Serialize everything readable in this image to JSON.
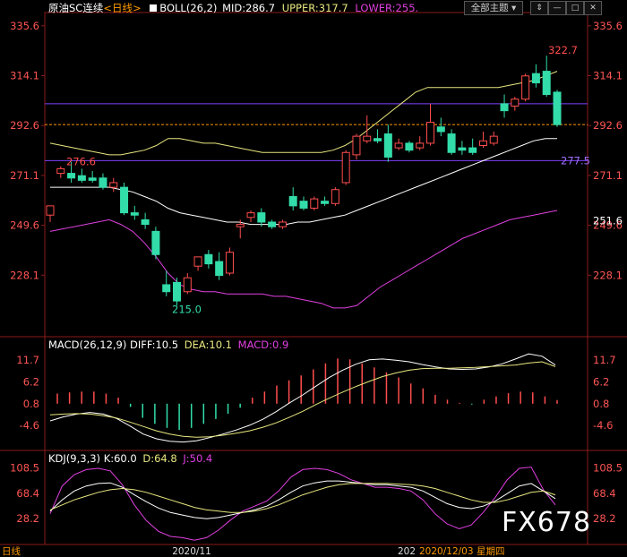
{
  "header": {
    "symbol": "原油SC连续",
    "period": "<日线>",
    "boll_label": "BOLL(26,2)",
    "mid": "MID:286.7",
    "upper": "UPPER:317.7",
    "lower": "LOWER:255.",
    "theme_button": "全部主题",
    "win_buttons": [
      "⇕",
      "—",
      "□",
      "✕"
    ]
  },
  "macd_header": {
    "label": "MACD(26,12,9)",
    "diff": "DIFF:10.5",
    "dea": "DEA:10.1",
    "macd": "MACD:0.9"
  },
  "kdj_header": {
    "label": "KDJ(9,3,3)",
    "k": "K:60.0",
    "d": "D:64.8",
    "j": "J:50.4"
  },
  "price_axis": [
    "335.6",
    "314.1",
    "292.6",
    "271.1",
    "249.6",
    "228.1"
  ],
  "price_axis_values": [
    335.6,
    314.1,
    292.6,
    271.1,
    249.6,
    228.1
  ],
  "price_right_extra": "251.6",
  "annotations": {
    "high": "322.7",
    "low": "215.0",
    "left_mark": "276.6",
    "line_mark": "277.5"
  },
  "macd_axis": [
    "11.7",
    "6.2",
    "0.8",
    "-4.6"
  ],
  "macd_axis_values": [
    11.7,
    6.2,
    0.8,
    -4.6
  ],
  "kdj_axis": [
    "108.5",
    "68.4",
    "28.2"
  ],
  "kdj_axis_values": [
    108.5,
    68.4,
    28.2
  ],
  "date_labels": [
    "2020/11",
    "202",
    "2020/12/03",
    "星期四"
  ],
  "bottom_left": "日线",
  "watermark": "FX678",
  "colors": {
    "up": "#ff4d4d",
    "down": "#33ddaa",
    "upper": "#e8e880",
    "mid": "#ffffff",
    "lower": "#e040e0",
    "purple_line": "#8040ff",
    "orange_dash": "#ff9900",
    "axis_text": "#ff5555",
    "header_mid": "#ffffff",
    "header_upper": "#e8e880",
    "header_lower": "#e040e0"
  },
  "chart_data": {
    "type": "candlestick",
    "ylim": [
      207,
      339
    ],
    "candles": [
      {
        "o": 254,
        "h": 257,
        "c": 258,
        "l": 251
      },
      {
        "o": 272,
        "h": 275,
        "c": 274,
        "l": 270
      },
      {
        "o": 272,
        "h": 277,
        "c": 270,
        "l": 268
      },
      {
        "o": 271,
        "h": 274,
        "c": 269,
        "l": 268
      },
      {
        "o": 270,
        "h": 273,
        "c": 269,
        "l": 268
      },
      {
        "o": 270,
        "h": 272,
        "c": 266,
        "l": 265
      },
      {
        "o": 266,
        "h": 270,
        "c": 268,
        "l": 264
      },
      {
        "o": 266,
        "h": 268,
        "c": 255,
        "l": 254
      },
      {
        "o": 255,
        "h": 258,
        "c": 254,
        "l": 252
      },
      {
        "o": 252,
        "h": 255,
        "c": 250,
        "l": 248
      },
      {
        "o": 247,
        "h": 249,
        "c": 237,
        "l": 235
      },
      {
        "o": 224,
        "h": 230,
        "c": 221,
        "l": 219
      },
      {
        "o": 225,
        "h": 227,
        "c": 217,
        "l": 215
      },
      {
        "o": 221,
        "h": 229,
        "c": 227,
        "l": 220
      },
      {
        "o": 232,
        "h": 235,
        "c": 236,
        "l": 230
      },
      {
        "o": 237,
        "h": 239,
        "c": 233,
        "l": 231
      },
      {
        "o": 234,
        "h": 238,
        "c": 228,
        "l": 226
      },
      {
        "o": 229,
        "h": 240,
        "c": 238,
        "l": 228
      },
      {
        "o": 249,
        "h": 252,
        "c": 250,
        "l": 244
      },
      {
        "o": 253,
        "h": 256,
        "c": 255,
        "l": 251
      },
      {
        "o": 255,
        "h": 257,
        "c": 251,
        "l": 249
      },
      {
        "o": 251,
        "h": 252,
        "c": 249,
        "l": 248
      },
      {
        "o": 249,
        "h": 252,
        "c": 251,
        "l": 248
      },
      {
        "o": 262,
        "h": 266,
        "c": 258,
        "l": 256
      },
      {
        "o": 260,
        "h": 262,
        "c": 257,
        "l": 256
      },
      {
        "o": 257,
        "h": 262,
        "c": 261,
        "l": 256
      },
      {
        "o": 260,
        "h": 262,
        "c": 259,
        "l": 258
      },
      {
        "o": 259,
        "h": 266,
        "c": 265,
        "l": 258
      },
      {
        "o": 268,
        "h": 282,
        "c": 281,
        "l": 267
      },
      {
        "o": 280,
        "h": 289,
        "c": 288,
        "l": 278
      },
      {
        "o": 286,
        "h": 297,
        "c": 288,
        "l": 285
      },
      {
        "o": 287,
        "h": 291,
        "c": 286,
        "l": 285
      },
      {
        "o": 289,
        "h": 293,
        "c": 279,
        "l": 277
      },
      {
        "o": 283,
        "h": 287,
        "c": 285,
        "l": 282
      },
      {
        "o": 285,
        "h": 286,
        "c": 282,
        "l": 281
      },
      {
        "o": 283,
        "h": 288,
        "c": 285,
        "l": 282
      },
      {
        "o": 285,
        "h": 302,
        "c": 294,
        "l": 284
      },
      {
        "o": 292,
        "h": 296,
        "c": 290,
        "l": 288
      },
      {
        "o": 289,
        "h": 291,
        "c": 281,
        "l": 280
      },
      {
        "o": 283,
        "h": 286,
        "c": 282,
        "l": 280
      },
      {
        "o": 283,
        "h": 287,
        "c": 281,
        "l": 280
      },
      {
        "o": 284,
        "h": 290,
        "c": 286,
        "l": 283
      },
      {
        "o": 285,
        "h": 290,
        "c": 288,
        "l": 284
      },
      {
        "o": 302,
        "h": 306,
        "c": 299,
        "l": 296
      },
      {
        "o": 301,
        "h": 305,
        "c": 304,
        "l": 299
      },
      {
        "o": 304,
        "h": 315,
        "c": 314,
        "l": 303
      },
      {
        "o": 315,
        "h": 319,
        "c": 311,
        "l": 309
      },
      {
        "o": 316,
        "h": 322.7,
        "c": 306,
        "l": 305
      },
      {
        "o": 307,
        "h": 308,
        "c": 293,
        "l": 292
      }
    ],
    "boll_upper": [
      285,
      284,
      283,
      282,
      281,
      280,
      280,
      281,
      282,
      284,
      287,
      287,
      286,
      285,
      285,
      284,
      283,
      282,
      281,
      281,
      281,
      281,
      281,
      281,
      282,
      284,
      287,
      291,
      295,
      299,
      303,
      307,
      309,
      309,
      309,
      309,
      309,
      309,
      309,
      310,
      311,
      312,
      314,
      316
    ],
    "boll_mid": [
      266,
      266,
      266,
      266,
      266,
      266,
      265,
      264,
      262,
      260,
      257,
      255,
      254,
      253,
      252,
      251,
      251,
      250,
      250,
      250,
      250,
      251,
      251,
      252,
      253,
      254,
      256,
      258,
      260,
      262,
      264,
      266,
      268,
      270,
      272,
      274,
      276,
      278,
      280,
      282,
      284,
      286,
      287,
      287
    ],
    "boll_lower": [
      247,
      248,
      249,
      250,
      251,
      252,
      250,
      247,
      242,
      236,
      229,
      224,
      222,
      221,
      221,
      220,
      220,
      220,
      220,
      219,
      219,
      218,
      217,
      216,
      214,
      214,
      215,
      219,
      223,
      226,
      229,
      232,
      235,
      238,
      241,
      244,
      246,
      248,
      250,
      252,
      253,
      254,
      255,
      256
    ],
    "macd_diff": [
      -3.5,
      -2.5,
      -1.8,
      -1.4,
      -1.8,
      -2.9,
      -4.8,
      -6.8,
      -8.0,
      -8.6,
      -8.8,
      -8.5,
      -7.7,
      -6.8,
      -5.8,
      -4.6,
      -3.1,
      -1.2,
      1.0,
      3.0,
      5.2,
      7.4,
      9.2,
      10.7,
      11.8,
      12.0,
      11.7,
      11.3,
      10.6,
      10.0,
      9.5,
      9.4,
      9.5,
      10.0,
      10.8,
      12.0,
      13.3,
      12.7,
      10.5
    ],
    "macd_dea": [
      -2.0,
      -1.8,
      -1.7,
      -1.8,
      -2.2,
      -2.8,
      -3.8,
      -4.9,
      -6.0,
      -6.8,
      -7.4,
      -7.6,
      -7.5,
      -7.1,
      -6.6,
      -6.0,
      -5.1,
      -4.0,
      -2.6,
      -1.1,
      0.6,
      2.2,
      3.7,
      5.1,
      6.4,
      7.6,
      8.5,
      9.2,
      9.6,
      9.7,
      9.7,
      9.8,
      9.9,
      10.1,
      10.3,
      10.5,
      11.0,
      11.3,
      10.1
    ],
    "macd_hist": [
      2.5,
      2.8,
      3.0,
      3.0,
      2.5,
      1.5,
      -0.8,
      -3.5,
      -5.0,
      -6.0,
      -6.5,
      -6.0,
      -5.0,
      -3.8,
      -2.5,
      -1.0,
      1.5,
      3.0,
      4.5,
      5.8,
      7.0,
      8.5,
      10.0,
      11.2,
      11.0,
      10.0,
      9.0,
      7.8,
      6.5,
      5.0,
      3.8,
      2.2,
      1.0,
      0.2,
      -0.2,
      1.0,
      1.8,
      2.6,
      3.0,
      2.8,
      1.8,
      0.9
    ],
    "kdj_k": [
      40,
      58,
      72,
      80,
      84,
      85,
      78,
      66,
      55,
      45,
      38,
      34,
      30,
      28,
      30,
      34,
      38,
      42,
      48,
      58,
      70,
      80,
      85,
      88,
      88,
      86,
      84,
      82,
      82,
      80,
      78,
      72,
      62,
      52,
      46,
      44,
      48,
      56,
      68,
      80,
      84,
      72,
      60
    ],
    "kdj_d": [
      42,
      50,
      58,
      64,
      70,
      74,
      76,
      74,
      70,
      64,
      58,
      52,
      46,
      42,
      40,
      38,
      38,
      40,
      44,
      50,
      58,
      66,
      72,
      78,
      82,
      84,
      84,
      84,
      84,
      83,
      82,
      80,
      76,
      70,
      64,
      58,
      54,
      54,
      58,
      64,
      70,
      72,
      66
    ],
    "kdj_j": [
      36,
      80,
      98,
      106,
      108,
      104,
      82,
      50,
      25,
      8,
      0,
      -2,
      -6,
      -2,
      10,
      26,
      40,
      48,
      56,
      72,
      94,
      106,
      108,
      106,
      100,
      90,
      84,
      78,
      78,
      76,
      72,
      58,
      36,
      20,
      12,
      18,
      38,
      62,
      90,
      108,
      110,
      74,
      50
    ]
  }
}
